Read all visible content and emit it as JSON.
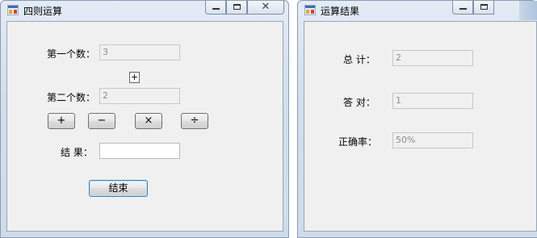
{
  "calc_window": {
    "title": "四则运算",
    "first_label": "第一个数：",
    "first_value": "3",
    "operator": "+",
    "second_label": "第二个数：",
    "second_value": "2",
    "buttons": [
      "+",
      "−",
      "×",
      "÷"
    ],
    "result_label": "结 果：",
    "result_value": "",
    "finish_label": "结束"
  },
  "result_window": {
    "title": "运算结果",
    "total_label": "总 计：",
    "total_value": "2",
    "correct_label": "答 对：",
    "correct_value": "1",
    "rate_label": "正确率：",
    "rate_value": "50%"
  },
  "icons": {
    "app": "app-icon",
    "minimize": "minimize-icon",
    "maximize": "maximize-icon",
    "close": "close-icon"
  }
}
